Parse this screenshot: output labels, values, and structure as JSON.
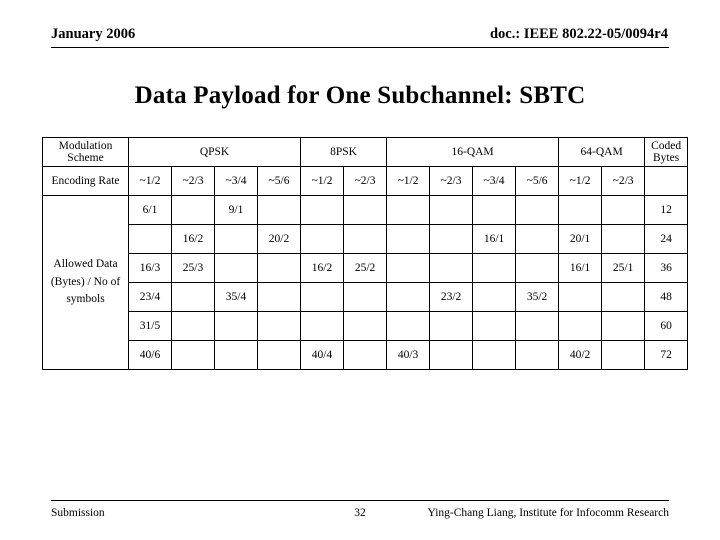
{
  "header": {
    "left": "January 2006",
    "right": "doc.: IEEE 802.22-05/0094r4"
  },
  "title": "Data Payload for One Subchannel: SBTC",
  "table": {
    "col0_header": "Modulation Scheme",
    "modulation_groups": [
      "QPSK",
      "8PSK",
      "16-QAM",
      "64-QAM"
    ],
    "coded_bytes_header": "Coded Bytes",
    "encoding_rate_label": "Encoding Rate",
    "encoding_rates": [
      "~1/2",
      "~2/3",
      "~3/4",
      "~5/6",
      "~1/2",
      "~2/3",
      "~1/2",
      "~2/3",
      "~3/4",
      "~5/6",
      "~1/2",
      "~2/3"
    ],
    "side_label": "Allowed Data (Bytes) / No of symbols",
    "rows": [
      {
        "cells": [
          "6/1",
          "",
          "9/1",
          "",
          "",
          "",
          "",
          "",
          "",
          "",
          "",
          ""
        ],
        "coded": "12"
      },
      {
        "cells": [
          "",
          "16/2",
          "",
          "20/2",
          "",
          "",
          "",
          "",
          "16/1",
          "",
          "20/1",
          ""
        ],
        "coded": "24"
      },
      {
        "cells": [
          "16/3",
          "25/3",
          "",
          "",
          "16/2",
          "25/2",
          "",
          "",
          "",
          "",
          "16/1",
          "25/1"
        ],
        "coded": "36"
      },
      {
        "cells": [
          "23/4",
          "",
          "35/4",
          "",
          "",
          "",
          "",
          "23/2",
          "",
          "35/2",
          "",
          ""
        ],
        "coded": "48"
      },
      {
        "cells": [
          "31/5",
          "",
          "",
          "",
          "",
          "",
          "",
          "",
          "",
          "",
          "",
          ""
        ],
        "coded": "60"
      },
      {
        "cells": [
          "40/6",
          "",
          "",
          "",
          "40/4",
          "",
          "40/3",
          "",
          "",
          "",
          "40/2",
          ""
        ],
        "coded": "72"
      }
    ]
  },
  "footer": {
    "left": "Submission",
    "center": "32",
    "right": "Ying-Chang Liang, Institute for Infocomm Research"
  }
}
